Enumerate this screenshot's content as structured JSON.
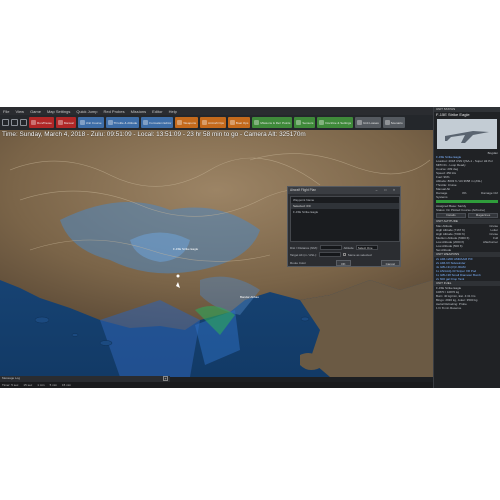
{
  "menu": [
    "File",
    "View",
    "Game",
    "Map Settings",
    "Quick Jump",
    "Red Probes",
    "Missions",
    "Editor",
    "Help"
  ],
  "toolbar": {
    "buttons": [
      {
        "label": "Run/Pause",
        "color": "#b02727"
      },
      {
        "label": "Manual",
        "color": "#b02727"
      },
      {
        "label": "Unit Course",
        "color": "#3e6ea8"
      },
      {
        "label": "Throttle & Altitude",
        "color": "#3e6ea8"
      },
      {
        "label": "Formation Editor",
        "color": "#3e6ea8"
      },
      {
        "label": "Weapons",
        "color": "#c46a1c"
      },
      {
        "label": "Aircraft Ops",
        "color": "#c46a1c"
      },
      {
        "label": "Boat Ops",
        "color": "#c46a1c"
      },
      {
        "label": "Missions & Ref. Points",
        "color": "#3f8a3a"
      },
      {
        "label": "Sensors",
        "color": "#3f8a3a"
      },
      {
        "label": "Doctrine & Settings",
        "color": "#3f8a3a"
      },
      {
        "label": "Unit Losses",
        "color": "#555a60"
      },
      {
        "label": "Scenario",
        "color": "#555a60"
      }
    ]
  },
  "timebar": "Time: Sunday, March 4, 2018 - Zulu: 09:51:09 - Local: 13:51:09 - 23 hr 58 min to go - Camera Alt: 325170m",
  "map": {
    "labels": [
      "F-15E Strike Eagle",
      "Bandar Abbas"
    ]
  },
  "dialog": {
    "title": "Aircraft Flight Plan",
    "body_lines": [
      "Waypoint Name",
      "Selected: 0/0",
      "F-15E Strike Eagle"
    ],
    "distance_label": "Dist / Distance (NM):",
    "altitude_label": "Altitude",
    "altitude_value": "Select One",
    "target_label": "Target Alt (m / ASL):",
    "same_as_selected": "Same as selected",
    "route_color_label": "Route Color",
    "ok_label": "OK",
    "cancel_label": "Cancel"
  },
  "message_log": {
    "label": "Message Log",
    "plus": "+"
  },
  "statusbar": [
    "Timer: 5 sec",
    "15 sec",
    "1 min",
    "5 min",
    "15 min"
  ],
  "side": {
    "unit_status_header": "UNIT STATUS",
    "unit_name": "F-15E Strike Eagle",
    "unit_side": "Bogdan",
    "unit_type_line": "F-15E Strike Eagle",
    "info_lines": [
      "Loadout: 2018 USN QSA-1 - Super Hit Pol",
      "MPD 01 - Loop Ready",
      "Course: 209 deg",
      "Speed: 450 kts",
      "Fuel: 96%",
      "Altitude: 8003 ft / Alt 3658 m (ASL)",
      "Throttle: Cruise",
      "Manual Alt"
    ],
    "damage_label": "Damage",
    "damage_value": "0%",
    "damage_ctrl": "Damage Ctrl",
    "systems_label": "Systems",
    "assigned_label": "Assigned Base: Saridy",
    "status_line": "Status: On Plotted Course (Airborne)",
    "hp_color": "#2f9d3b",
    "btn_details": "Details",
    "btn_magazines": "Magazines",
    "altitude_header": "UNIT ALTITUDE",
    "alt_rows": [
      [
        "Max Altitude",
        "Cruise"
      ],
      [
        "High Altitude (7167 ft)",
        "Loiter"
      ],
      [
        "High Altitude (7000 ft)",
        "Cruise"
      ],
      [
        "Medium Altitude (5000 ft)",
        "Full"
      ],
      [
        "Low Altitude (2000 ft)",
        "Afterburner"
      ],
      [
        "Low Altitude (500 ft)",
        ""
      ],
      [
        "Set Altitude",
        ""
      ]
    ],
    "weapons_header": "UNIT WEAPONS",
    "weapons_lines": [
      "2x AIM-120D AMRAAM P3I",
      "2x AIM-9X Sidewinder",
      "4x GBU-31(V)3 JDAM",
      "1x AN/AAQ-33 Sniper XR Pod",
      "1x GBU-38 Small Diameter Bomb",
      "2x 600 gal Drop Tank"
    ],
    "fuel_header": "UNIT FUEL",
    "fuel_lines": [
      "F-15E Strike Eagle",
      "10870 / 10870 kg",
      "Burn: 40 kg/min, Est. 4:31 hrs",
      "Bingo: 2930 kg, Joker: 3500 kg",
      "Aerial Refueling: Probe",
      "1 hr 8 min Reserve"
    ]
  }
}
